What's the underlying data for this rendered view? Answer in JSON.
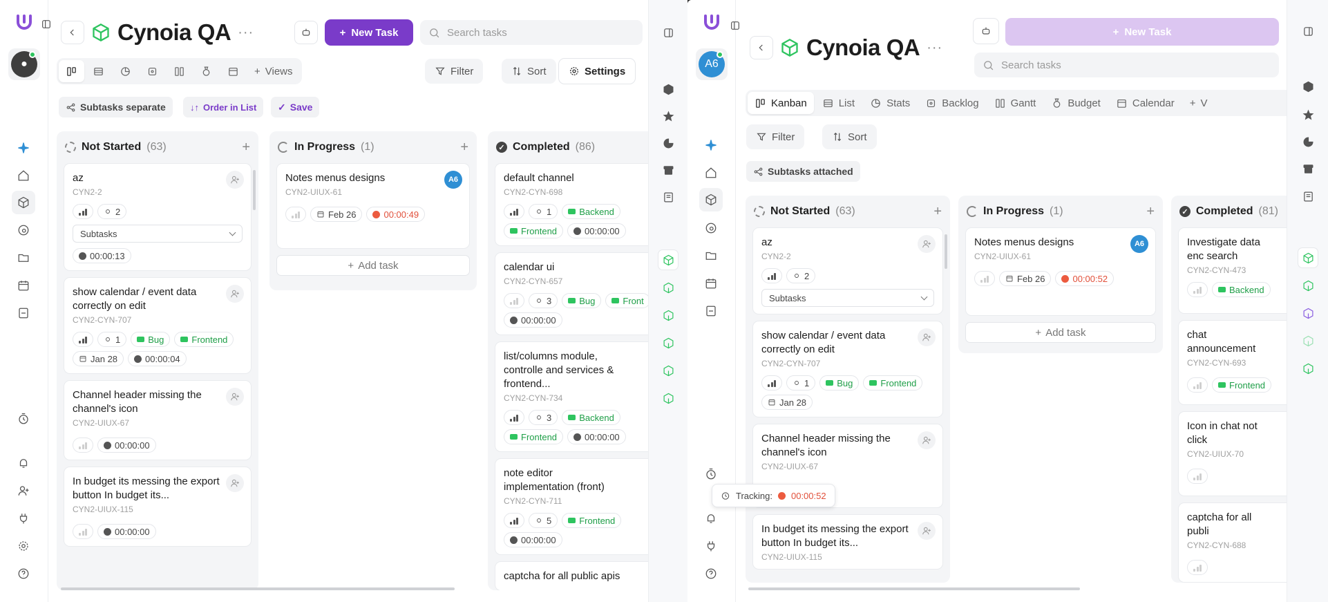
{
  "project": {
    "title": "Cynoia QA",
    "more": "···"
  },
  "search_placeholder": "Search tasks",
  "new_task_label": "New Task",
  "avatar_initials": "A6",
  "toolbar": {
    "views": "Views",
    "filter": "Filter",
    "sort": "Sort",
    "settings": "Settings",
    "subtasks_separate": "Subtasks separate",
    "order_in_list": "Order in List",
    "save": "Save",
    "subtasks_attached": "Subtasks attached"
  },
  "tabs": [
    "Kanban",
    "List",
    "Stats",
    "Backlog",
    "Gantt",
    "Budget",
    "Calendar",
    "Views"
  ],
  "columns_left": [
    {
      "name": "Not Started",
      "count": "(63)"
    },
    {
      "name": "In Progress",
      "count": "(1)"
    },
    {
      "name": "Completed",
      "count": "(86)"
    }
  ],
  "columns_right": [
    {
      "name": "Not Started",
      "count": "(63)"
    },
    {
      "name": "In Progress",
      "count": "(1)"
    },
    {
      "name": "Completed",
      "count": "(81)"
    }
  ],
  "add_task": "Add task",
  "subtasks_select": "Subtasks",
  "tags": {
    "backend": "Backend",
    "frontend": "Frontend",
    "bug": "Bug",
    "front_cut": "Front"
  },
  "left": {
    "ns": [
      {
        "title": "az",
        "id": "CYN2-2",
        "sub": "2",
        "time": "00:00:13"
      },
      {
        "title": "show calendar / event data correctly on edit",
        "id": "CYN2-CYN-707",
        "sub": "1",
        "date": "Jan 28",
        "time": "00:00:04"
      },
      {
        "title": "Channel header missing the channel's icon",
        "id": "CYN2-UIUX-67",
        "time": "00:00:00"
      },
      {
        "title": "In budget its messing the export button In budget its...",
        "id": "CYN2-UIUX-115",
        "time": "00:00:00"
      }
    ],
    "ip": [
      {
        "title": "Notes menus designs",
        "id": "CYN2-UIUX-61",
        "date": "Feb 26",
        "time": "00:00:49"
      }
    ],
    "done": [
      {
        "title": "default channel",
        "id": "CYN2-CYN-698",
        "sub": "1",
        "time": "00:00:00"
      },
      {
        "title": "calendar ui",
        "id": "CYN2-CYN-657",
        "sub": "3",
        "time": "00:00:00"
      },
      {
        "title": "list/columns module, controlle and services & frontend...",
        "id": "CYN2-CYN-734",
        "sub": "3",
        "time": "00:00:00"
      },
      {
        "title": "note editor implementation (front)",
        "id": "CYN2-CYN-711",
        "sub": "5",
        "time": "00:00:00"
      },
      {
        "title": "captcha for all public apis"
      }
    ]
  },
  "right": {
    "ns": [
      {
        "title": "az",
        "id": "CYN2-2",
        "sub": "2"
      },
      {
        "title": "show calendar / event data correctly on edit",
        "id": "CYN2-CYN-707",
        "sub": "1",
        "date": "Jan 28"
      },
      {
        "title": "Channel header missing the channel's icon",
        "id": "CYN2-UIUX-67"
      },
      {
        "title": "In budget its messing the export button In budget its...",
        "id": "CYN2-UIUX-115"
      }
    ],
    "ip": [
      {
        "title": "Notes menus designs",
        "id": "CYN2-UIUX-61",
        "date": "Feb 26",
        "time": "00:00:52"
      }
    ],
    "done": [
      {
        "title": "Investigate data enc search",
        "id": "CYN2-CYN-473"
      },
      {
        "title": "chat announcement",
        "id": "CYN2-CYN-693"
      },
      {
        "title": "Icon in chat not click",
        "id": "CYN2-UIUX-70"
      },
      {
        "title": "captcha for all publi",
        "id": "CYN2-CYN-688"
      }
    ]
  },
  "tracking": {
    "label": "Tracking:",
    "time": "00:00:52"
  },
  "colors": {
    "accent": "#7a3bc9",
    "green": "#2ec45f",
    "red": "#ec5b3f",
    "blue": "#2f8fd4"
  }
}
